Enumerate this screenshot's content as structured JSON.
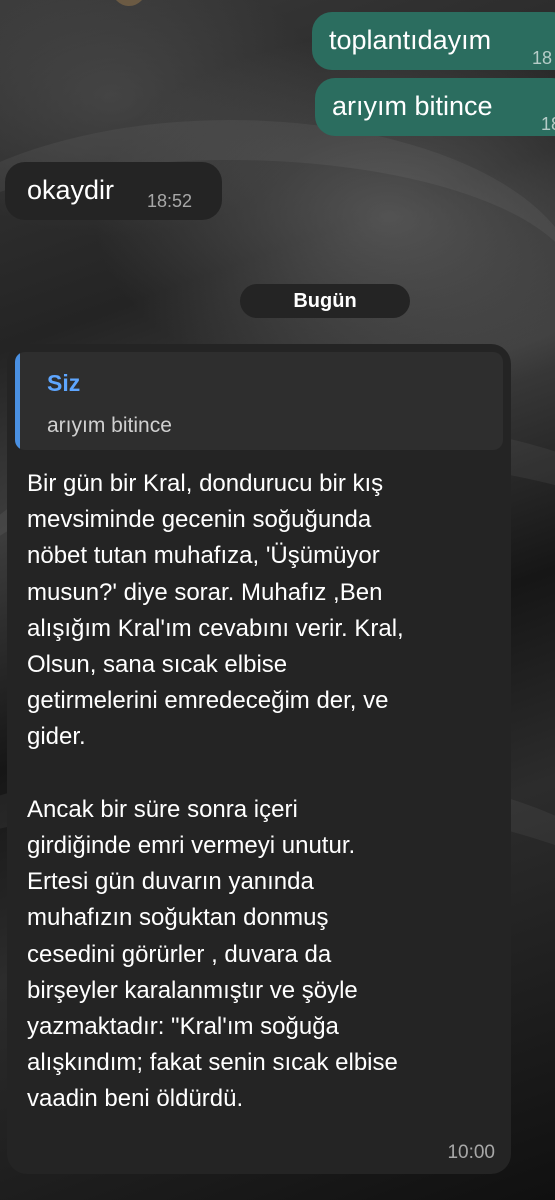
{
  "messages": {
    "out1": {
      "text": "toplantıdayım",
      "time": "18"
    },
    "out2": {
      "text": "arıyım bitince",
      "time": "18"
    },
    "in1": {
      "text": "okaydir",
      "time": "18:52"
    }
  },
  "day_separator": "Bugün",
  "long_message": {
    "reply": {
      "author": "Siz",
      "text": "arıyım bitince"
    },
    "body": "Bir gün bir Kral, dondurucu bir kış\nmevsiminde gecenin soğuğunda\nnöbet tutan muhafıza, 'Üşümüyor\nmusun?' diye sorar. Muhafız ,Ben\nalışığım Kral'ım cevabını verir. Kral,\nOlsun, sana sıcak elbise\ngetirmelerini emredeceğim der, ve\ngider.\n\nAncak bir süre sonra içeri\ngirdiğinde emri vermeyi unutur.\nErtesi gün duvarın yanında\nmuhafızın soğuktan donmuş\ncesedini görürler , duvara da\nbirşeyler karalanmıştır ve şöyle\nyazmaktadır: \"Kral'ım soğuğa\nalışkındım; fakat senin sıcak elbise\nvaadin beni öldürdü.",
    "time": "10:00"
  }
}
